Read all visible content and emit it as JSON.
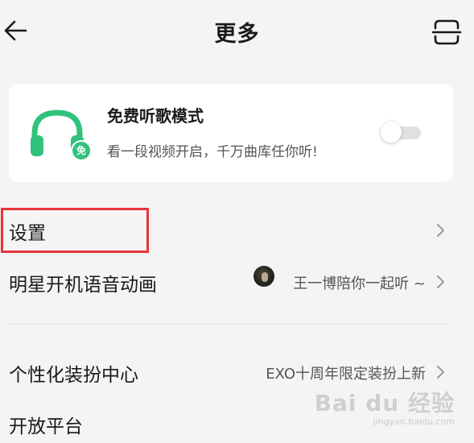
{
  "header": {
    "title": "更多",
    "back_icon": "arrow-left-icon",
    "scan_icon": "scan-icon"
  },
  "free_mode_card": {
    "title": "免费听歌模式",
    "subtitle": "看一段视频开启，千万曲库任你听!",
    "badge": "免",
    "toggle_on": false,
    "accent_color": "#31c27c"
  },
  "menu": [
    {
      "label": "设置",
      "value": ""
    },
    {
      "label": "明星开机语音动画",
      "value": "王一博陪你一起听 ~"
    },
    {
      "label": "个性化装扮中心",
      "value": "EXO十周年限定装扮上新"
    },
    {
      "label": "开放平台",
      "value": ""
    }
  ],
  "highlight_color": "#e8343a",
  "watermark": {
    "main": "Bai du 经验",
    "url": "jingyan.baidu.com"
  }
}
